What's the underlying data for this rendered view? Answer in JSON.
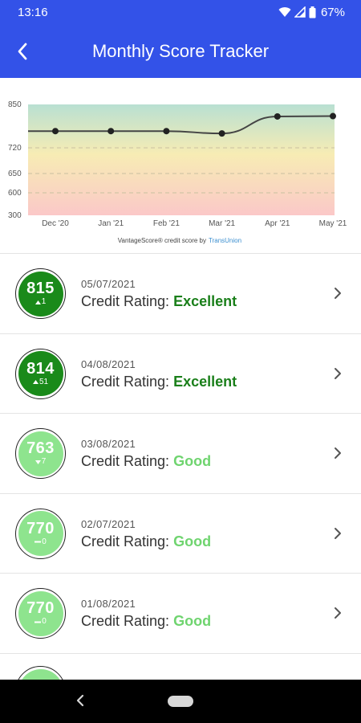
{
  "status_bar": {
    "time": "13:16",
    "battery": "67%",
    "icons": [
      "wifi-icon",
      "signal-icon",
      "battery-icon"
    ]
  },
  "app_bar": {
    "title": "Monthly Score Tracker",
    "back_icon": "chevron-left-icon"
  },
  "chart_data": {
    "type": "line",
    "categories": [
      "Dec '20",
      "Jan '21",
      "Feb '21",
      "Mar '21",
      "Apr '21",
      "May '21"
    ],
    "series": [
      {
        "values": [
          770,
          770,
          770,
          763,
          814,
          815
        ]
      }
    ],
    "y_ticks": [
      300,
      600,
      650,
      720,
      850
    ],
    "ylim": [
      300,
      850
    ],
    "footer_text": "VantageScore® credit score by",
    "footer_brand": "TransUnion",
    "colors": {
      "line": "#444444",
      "band_top": "#b8e0d2",
      "band_mid": "#f7ecb4",
      "band_bottom": "#fbc8c8"
    }
  },
  "records": [
    {
      "score": "815",
      "delta": "1",
      "direction": "up",
      "date": "05/07/2021",
      "label": "Credit Rating:",
      "rating": "Excellent",
      "level": "excellent"
    },
    {
      "score": "814",
      "delta": "51",
      "direction": "up",
      "date": "04/08/2021",
      "label": "Credit Rating:",
      "rating": "Excellent",
      "level": "excellent"
    },
    {
      "score": "763",
      "delta": "7",
      "direction": "down",
      "date": "03/08/2021",
      "label": "Credit Rating:",
      "rating": "Good",
      "level": "good"
    },
    {
      "score": "770",
      "delta": "0",
      "direction": "flat",
      "date": "02/07/2021",
      "label": "Credit Rating:",
      "rating": "Good",
      "level": "good"
    },
    {
      "score": "770",
      "delta": "0",
      "direction": "flat",
      "date": "01/08/2021",
      "label": "Credit Rating:",
      "rating": "Good",
      "level": "good"
    }
  ],
  "colors": {
    "app_bar": "#3352e8",
    "excellent": "#1a8a1a",
    "good": "#8ee48e",
    "good_text": "#6fd46f",
    "excellent_text": "#1a7f1a"
  }
}
